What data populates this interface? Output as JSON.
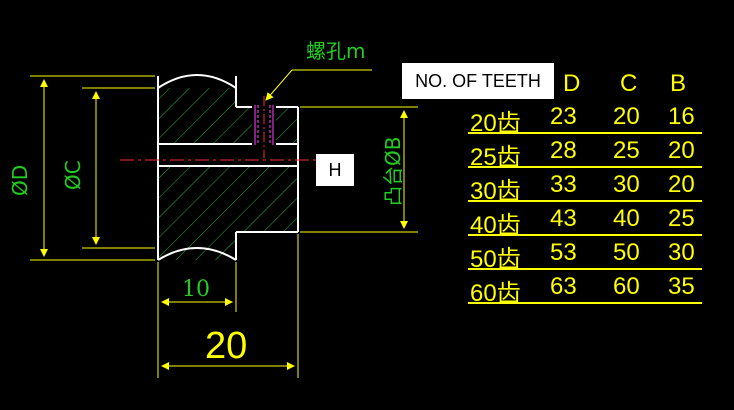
{
  "drawing": {
    "screw_hole_label": "螺孔m",
    "dim_diameter_d": "ØD",
    "dim_diameter_c": "ØC",
    "dim_boss_b": "凸台ØB",
    "dim_length_10": "10",
    "dim_length_20": "20",
    "h_label": "H",
    "colors": {
      "drawing_line": "#ffffff",
      "hatch": "#1fb34a",
      "dimension": "#22cc22",
      "yellow": "#ffff00",
      "red": "#ff2a2a",
      "magenta": "#ff44ff"
    }
  },
  "table": {
    "teeth_header": "NO. OF TEETH",
    "col_d": "D",
    "col_c": "C",
    "col_b": "B",
    "rows": [
      {
        "teeth": "20齿",
        "d": "23",
        "c": "20",
        "b": "16"
      },
      {
        "teeth": "25齿",
        "d": "28",
        "c": "25",
        "b": "20"
      },
      {
        "teeth": "30齿",
        "d": "33",
        "c": "30",
        "b": "20"
      },
      {
        "teeth": "40齿",
        "d": "43",
        "c": "40",
        "b": "25"
      },
      {
        "teeth": "50齿",
        "d": "53",
        "c": "50",
        "b": "30"
      },
      {
        "teeth": "60齿",
        "d": "63",
        "c": "60",
        "b": "35"
      }
    ]
  }
}
